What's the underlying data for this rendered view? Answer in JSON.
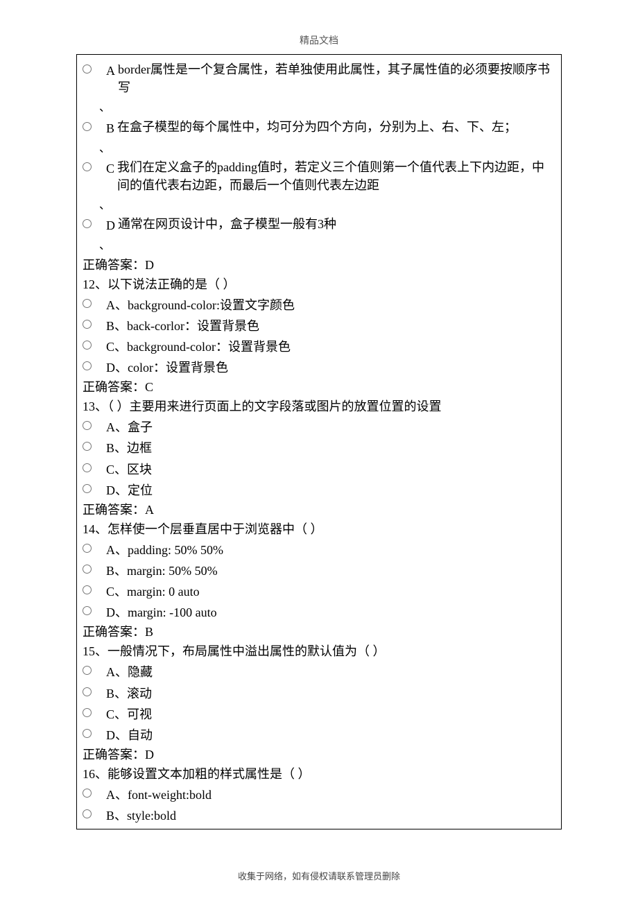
{
  "header": "精品文档",
  "footer": "收集于网络，如有侵权请联系管理员删除",
  "q11": {
    "optA_letter": "A",
    "optA_text": "border属性是一个复合属性，若单独使用此属性，其子属性值的必须要按顺序书写",
    "optB_letter": "B",
    "optB_text": "在盒子模型的每个属性中，均可分为四个方向，分别为上、右、下、左；",
    "optC_letter": "C",
    "optC_text": "我们在定义盒子的padding值时，若定义三个值则第一个值代表上下内边距，中间的值代表右边距，而最后一个值则代表左边距",
    "optD_letter": "D",
    "optD_text": "通常在网页设计中，盒子模型一般有3种",
    "answer": "正确答案：D"
  },
  "q12": {
    "title": "12、以下说法正确的是（ ）",
    "optA": "A、background-color:设置文字颜色",
    "optB": "B、back-corlor：设置背景色",
    "optC": "C、background-color：设置背景色",
    "optD": "D、color：设置背景色",
    "answer": "正确答案：C"
  },
  "q13": {
    "title": "13、（ ）主要用来进行页面上的文字段落或图片的放置位置的设置",
    "optA": "A、盒子",
    "optB": "B、边框",
    "optC": "C、区块",
    "optD": "D、定位",
    "answer": "正确答案：A"
  },
  "q14": {
    "title": "14、怎样使一个层垂直居中于浏览器中（ ）",
    "optA": "A、padding: 50% 50%",
    "optB": "B、margin: 50% 50%",
    "optC": "C、margin: 0 auto",
    "optD": "D、margin: -100 auto",
    "answer": "正确答案：B"
  },
  "q15": {
    "title": "15、一般情况下，布局属性中溢出属性的默认值为（ ）",
    "optA": "A、隐藏",
    "optB": "B、滚动",
    "optC": "C、可视",
    "optD": "D、自动",
    "answer": "正确答案：D"
  },
  "q16": {
    "title": "16、能够设置文本加粗的样式属性是（ ）",
    "optA": "A、font-weight:bold",
    "optB": "B、style:bold"
  },
  "caret": "、"
}
